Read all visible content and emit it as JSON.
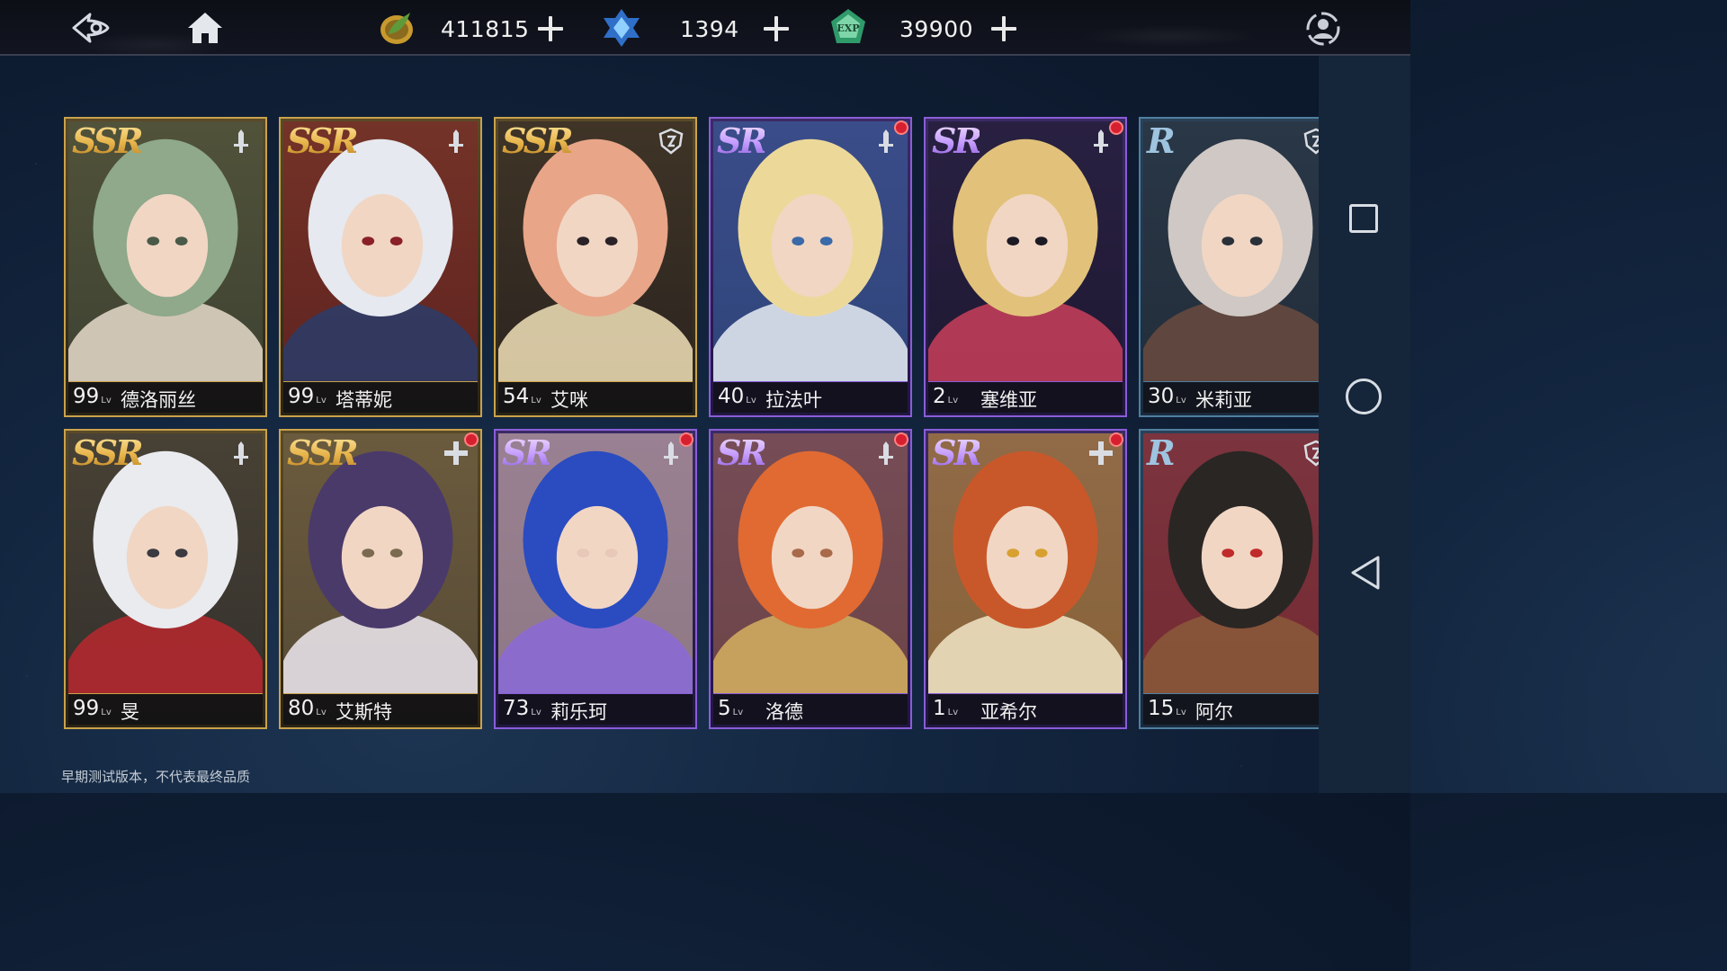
{
  "topbar": {
    "back_icon": "back-eye-arrow-icon",
    "home_icon": "home-icon",
    "resources": [
      {
        "name": "gold-leaf-coin",
        "icon": "gold-coin-icon",
        "value": "411815",
        "color": "#d9b24a"
      },
      {
        "name": "blue-crystal",
        "icon": "blue-crystal-icon",
        "value": "1394",
        "color": "#3a8be0"
      },
      {
        "name": "exp-gem",
        "icon": "exp-gem-icon",
        "value": "39900",
        "color": "#2f9a6a"
      }
    ],
    "profile_icon": "profile-icon"
  },
  "cards": [
    {
      "rarity": "SSR",
      "level": "99",
      "level_tag": "Lv",
      "name": "德洛丽丝",
      "class_icon": "sword-icon",
      "notification": false,
      "palette": [
        "#8fa98a",
        "#e8dccb",
        "#4a5a48"
      ]
    },
    {
      "rarity": "SSR",
      "level": "99",
      "level_tag": "Lv",
      "name": "塔蒂妮",
      "class_icon": "sword-icon",
      "notification": false,
      "palette": [
        "#e6e9ef",
        "#2a3c6a",
        "#8a2028"
      ]
    },
    {
      "rarity": "SSR",
      "level": "54",
      "level_tag": "Lv",
      "name": "艾咪",
      "class_icon": "shield-icon",
      "notification": false,
      "palette": [
        "#e8a588",
        "#f2e2b8",
        "#2a2226"
      ]
    },
    {
      "rarity": "SR",
      "level": "40",
      "level_tag": "Lv",
      "name": "拉法叶",
      "class_icon": "sword-icon",
      "notification": true,
      "palette": [
        "#ecd99a",
        "#e9eef4",
        "#3a6aa8"
      ]
    },
    {
      "rarity": "SR",
      "level": "2",
      "level_tag": "Lv",
      "name": "塞维亚",
      "class_icon": "sword-icon",
      "notification": true,
      "palette": [
        "#e2c27a",
        "#c9405a",
        "#1c1a24"
      ]
    },
    {
      "rarity": "R",
      "level": "30",
      "level_tag": "Lv",
      "name": "米莉亚",
      "class_icon": "shield-icon",
      "notification": true,
      "palette": [
        "#cfc8c4",
        "#6a4a3e",
        "#2a3038"
      ]
    },
    {
      "rarity": "SSR",
      "level": "99",
      "level_tag": "Lv",
      "name": "旻",
      "class_icon": "sword-icon",
      "notification": false,
      "palette": [
        "#e9ebef",
        "#b8282e",
        "#3a3a40"
      ]
    },
    {
      "rarity": "SSR",
      "level": "80",
      "level_tag": "Lv",
      "name": "艾斯特",
      "class_icon": "cross-icon",
      "notification": true,
      "palette": [
        "#4a3a6a",
        "#eeeaf2",
        "#7a6a50"
      ]
    },
    {
      "rarity": "SR",
      "level": "73",
      "level_tag": "Lv",
      "name": "莉乐珂",
      "class_icon": "sword-icon",
      "notification": true,
      "palette": [
        "#2a4cc0",
        "#8a6ad8",
        "#e8c8b8"
      ]
    },
    {
      "rarity": "SR",
      "level": "5",
      "level_tag": "Lv",
      "name": "洛德",
      "class_icon": "sword-icon",
      "notification": true,
      "palette": [
        "#e06a32",
        "#d6b060",
        "#a86a4a"
      ]
    },
    {
      "rarity": "SR",
      "level": "1",
      "level_tag": "Lv",
      "name": "亚希尔",
      "class_icon": "cross-icon",
      "notification": true,
      "palette": [
        "#c8582a",
        "#f2e6c8",
        "#d8a030"
      ]
    },
    {
      "rarity": "R",
      "level": "15",
      "level_tag": "Lv",
      "name": "阿尔",
      "class_icon": "shield-icon",
      "notification": true,
      "palette": [
        "#2a2624",
        "#8a5a3a",
        "#c02a2a"
      ]
    }
  ],
  "footer": {
    "notice": "早期测试版本，不代表最终品质"
  },
  "navbar": {
    "recent_icon": "recent-apps-square-icon",
    "home_icon": "home-circle-icon",
    "back_icon": "back-triangle-icon"
  }
}
